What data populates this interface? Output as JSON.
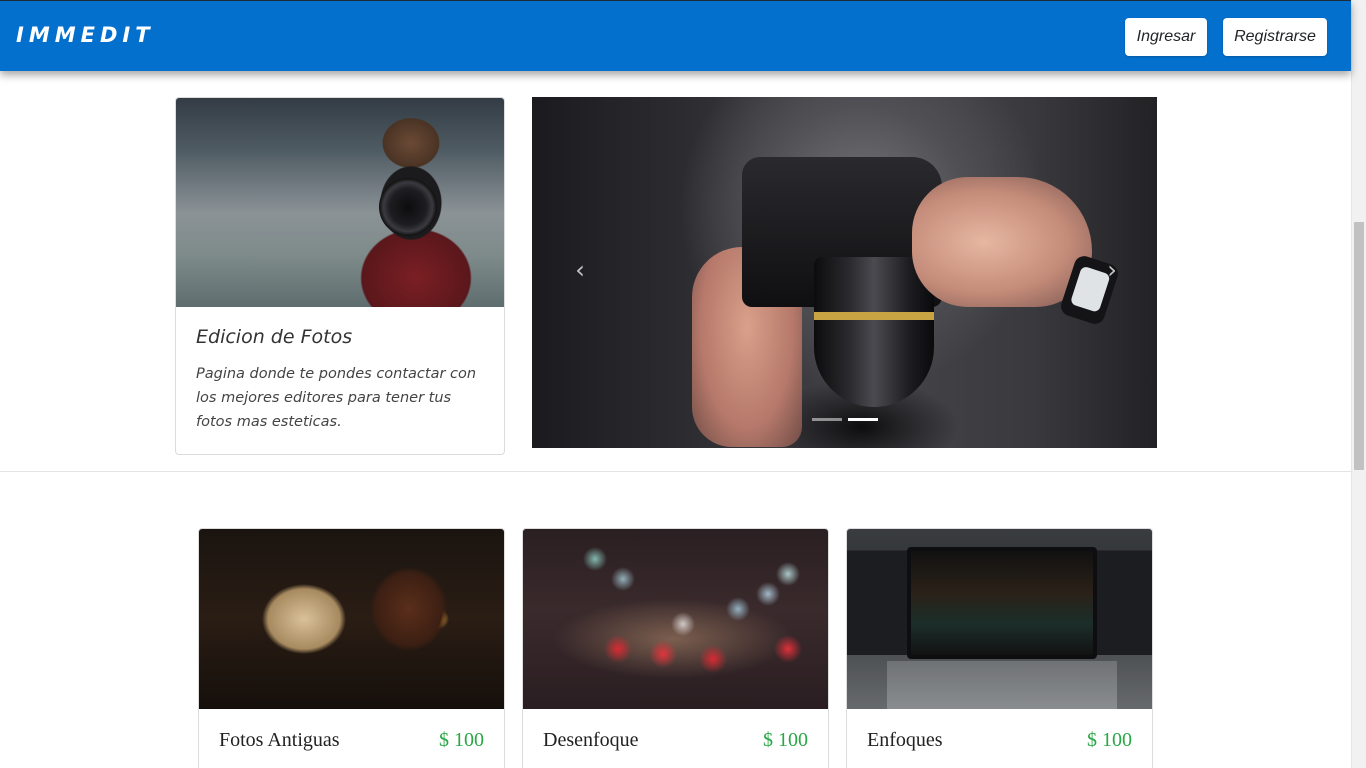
{
  "navbar": {
    "brand": "IMMEDIT",
    "login_label": "Ingresar",
    "register_label": "Registrarse",
    "background": "#0470cd"
  },
  "hero": {
    "title": "Edicion de Fotos",
    "text": "Pagina donde te pondes contactar con los mejores editores para tener tus fotos mas esteticas."
  },
  "carousel": {
    "prev_icon": "‹",
    "next_icon": "›",
    "slides": 2,
    "active_slide": 2
  },
  "products": [
    {
      "name": "Fotos Antiguas",
      "price": "$ 100"
    },
    {
      "name": "Desenfoque",
      "price": "$ 100"
    },
    {
      "name": "Enfoques",
      "price": "$ 100"
    }
  ],
  "colors": {
    "accent": "#0470cd",
    "price": "#28a745"
  }
}
